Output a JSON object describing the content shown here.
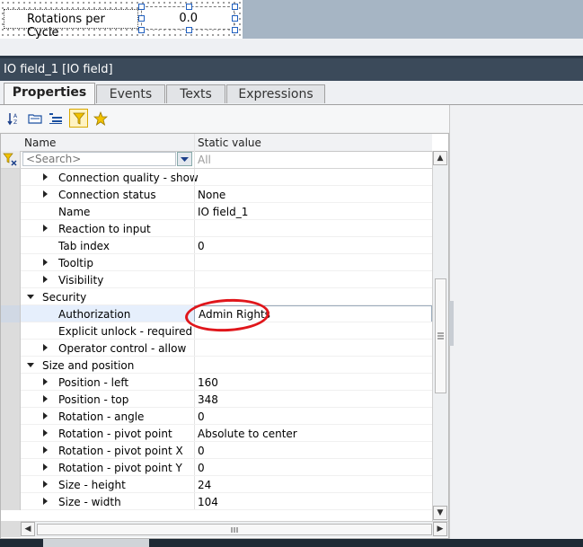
{
  "canvas": {
    "label_text": "Rotations per Cycle",
    "field_value": "0.0"
  },
  "panel": {
    "title": "IO field_1 [IO field]"
  },
  "tabs": [
    {
      "label": "Properties",
      "active": true
    },
    {
      "label": "Events",
      "active": false
    },
    {
      "label": "Texts",
      "active": false
    },
    {
      "label": "Expressions",
      "active": false
    }
  ],
  "toolbar": {
    "icons": [
      "sort-az-icon",
      "folder-icon",
      "list-tree-icon",
      "filter-icon",
      "favorite-star-icon"
    ]
  },
  "grid": {
    "col_name": "Name",
    "col_value": "Static value",
    "search_placeholder": "<Search>",
    "filter_value": "All",
    "rows": [
      {
        "name": "Connection quality - show",
        "value": "",
        "expander": "collapsed",
        "indent": 2
      },
      {
        "name": "Connection status",
        "value": "None",
        "expander": "collapsed",
        "indent": 2
      },
      {
        "name": "Name",
        "value": "IO field_1",
        "expander": "none",
        "indent": 2
      },
      {
        "name": "Reaction to input",
        "value": "",
        "expander": "collapsed",
        "indent": 2
      },
      {
        "name": "Tab index",
        "value": "0",
        "expander": "none",
        "indent": 2
      },
      {
        "name": "Tooltip",
        "value": "",
        "expander": "collapsed",
        "indent": 2
      },
      {
        "name": "Visibility",
        "value": "",
        "expander": "collapsed",
        "indent": 2
      },
      {
        "name": "Security",
        "value": "",
        "expander": "expanded",
        "indent": 1
      },
      {
        "name": "Authorization",
        "value": "Admin Rights",
        "expander": "none",
        "indent": 2,
        "selected": true
      },
      {
        "name": "Explicit unlock - required",
        "value": "",
        "expander": "none",
        "indent": 2
      },
      {
        "name": "Operator control - allow",
        "value": "",
        "expander": "collapsed",
        "indent": 2
      },
      {
        "name": "Size and position",
        "value": "",
        "expander": "expanded",
        "indent": 1
      },
      {
        "name": "Position - left",
        "value": "160",
        "expander": "collapsed",
        "indent": 2
      },
      {
        "name": "Position - top",
        "value": "348",
        "expander": "collapsed",
        "indent": 2
      },
      {
        "name": "Rotation - angle",
        "value": "0",
        "expander": "collapsed",
        "indent": 2
      },
      {
        "name": "Rotation - pivot point",
        "value": "Absolute to center",
        "expander": "collapsed",
        "indent": 2
      },
      {
        "name": "Rotation - pivot point X",
        "value": "0",
        "expander": "collapsed",
        "indent": 2
      },
      {
        "name": "Rotation - pivot point Y",
        "value": "0",
        "expander": "collapsed",
        "indent": 2
      },
      {
        "name": "Size - height",
        "value": "24",
        "expander": "collapsed",
        "indent": 2
      },
      {
        "name": "Size - width",
        "value": "104",
        "expander": "collapsed",
        "indent": 2
      }
    ]
  },
  "annotation": {
    "highlight_color": "#e0161b"
  },
  "colors": {
    "panel_header": "#3b4a5a",
    "selected_row": "#e6effc"
  }
}
